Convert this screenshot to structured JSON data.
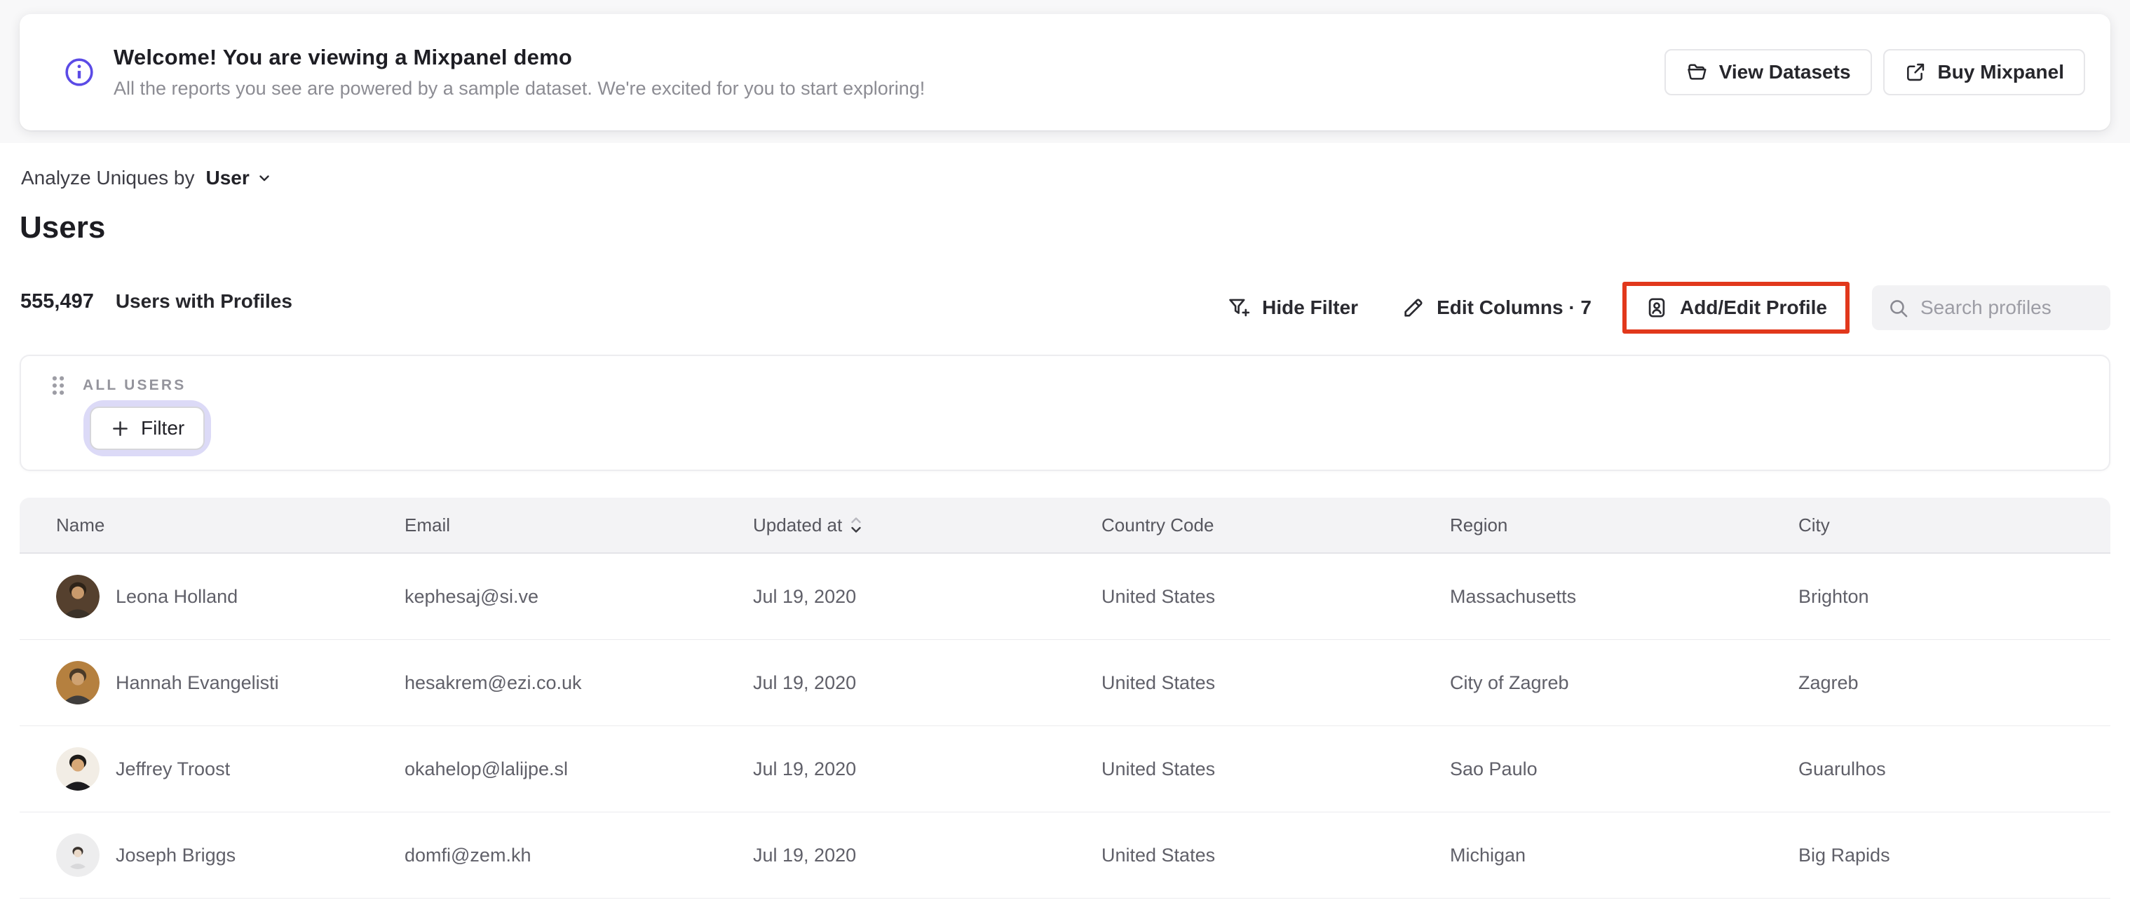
{
  "banner": {
    "title": "Welcome! You are viewing a Mixpanel demo",
    "subtitle": "All the reports you see are powered by a sample dataset. We're excited for you to start exploring!",
    "view_datasets_label": "View Datasets",
    "buy_mixpanel_label": "Buy Mixpanel"
  },
  "controls": {
    "analyze_prefix": "Analyze Uniques by",
    "analyze_value": "User"
  },
  "page_title": "Users",
  "stats": {
    "count": "555,497",
    "label": "Users with Profiles"
  },
  "toolbar": {
    "hide_filter_label": "Hide Filter",
    "edit_columns_label": "Edit Columns · 7",
    "add_edit_profile_label": "Add/Edit Profile",
    "search_placeholder": "Search profiles"
  },
  "filter_panel": {
    "group_label": "ALL USERS",
    "filter_button_label": "Filter"
  },
  "table": {
    "columns": [
      {
        "label": "Name"
      },
      {
        "label": "Email"
      },
      {
        "label": "Updated at",
        "sort": "desc"
      },
      {
        "label": "Country Code"
      },
      {
        "label": "Region"
      },
      {
        "label": "City"
      }
    ],
    "rows": [
      {
        "name": "Leona Holland",
        "email": "kephesaj@si.ve",
        "updated_at": "Jul 19, 2020",
        "country": "United States",
        "region": "Massachusetts",
        "city": "Brighton",
        "avatar": {
          "bg": "#55402e",
          "skin": "#c99a6c",
          "hair": "#2e2318",
          "top": "#3a3128",
          "scale": 1
        }
      },
      {
        "name": "Hannah Evangelisti",
        "email": "hesakrem@ezi.co.uk",
        "updated_at": "Jul 19, 2020",
        "country": "United States",
        "region": "City of Zagreb",
        "city": "Zagreb",
        "avatar": {
          "bg": "#b5803f",
          "skin": "#cfa271",
          "hair": "#4a3a28",
          "top": "#3f3d3c",
          "scale": 1
        }
      },
      {
        "name": "Jeffrey Troost",
        "email": "okahelop@lalijpe.sl",
        "updated_at": "Jul 19, 2020",
        "country": "United States",
        "region": "Sao Paulo",
        "city": "Guarulhos",
        "avatar": {
          "bg": "#f2ede5",
          "skin": "#d7a877",
          "hair": "#1d1a18",
          "top": "#1c1b1e",
          "scale": 1
        }
      },
      {
        "name": "Joseph Briggs",
        "email": "domfi@zem.kh",
        "updated_at": "Jul 19, 2020",
        "country": "United States",
        "region": "Michigan",
        "city": "Big Rapids",
        "avatar": {
          "bg": "#ededee",
          "skin": "#ead9c8",
          "hair": "#3a332e",
          "top": "#d8d8da",
          "scale": 0.62
        }
      }
    ]
  },
  "colors": {
    "accent_purple": "#5b4be6",
    "annotation_red": "#e1381c",
    "focus_ring_lavender": "#dcdaf7",
    "header_bg": "#f3f3f5",
    "search_bg": "#f2f2f4",
    "row_border": "#ebebee",
    "text_dark": "#222228",
    "text_gray": "#8c8c93",
    "cell_text": "#606069"
  },
  "icons": {
    "info": "info-icon",
    "folder": "folder-icon",
    "external_link": "external-link-icon",
    "chevron_down": "chevron-down-icon",
    "funnel_plus": "filter-funnel-icon",
    "pencil": "pencil-icon",
    "contact_card": "profile-card-icon",
    "search": "search-icon",
    "drag": "drag-handle-icon",
    "plus": "plus-icon",
    "sort": "sort-icon"
  }
}
